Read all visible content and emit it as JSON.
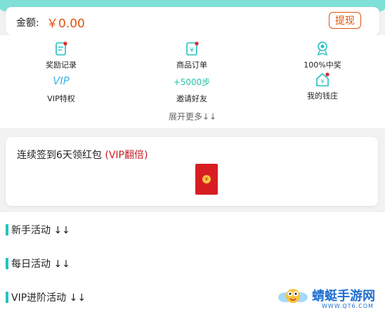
{
  "balance": {
    "label": "金额:",
    "value": "￥0.00",
    "withdraw_label": "提现"
  },
  "grid": [
    {
      "label": "奖励记录",
      "icon": "reward-record-icon"
    },
    {
      "label": "商品订单",
      "icon": "product-order-icon"
    },
    {
      "label": "100%中奖",
      "icon": "prize-medal-icon"
    },
    {
      "label": "VIP特权",
      "top_text": "VIP"
    },
    {
      "label": "邀请好友",
      "top_text": "+5000步"
    },
    {
      "label": "我的钱庄",
      "icon": "money-house-icon"
    }
  ],
  "expand_more": "展开更多↓↓",
  "checkin": {
    "title": "连续签到6天领红包 ",
    "vip_note": "(VIP翻倍)",
    "packet_icon": "red-packet-icon"
  },
  "activities": [
    {
      "label": "新手活动 ↓↓"
    },
    {
      "label": "每日活动 ↓↓"
    },
    {
      "label": "VIP进阶活动 ↓↓"
    }
  ],
  "watermark": {
    "brand": "蜻蜓手游网",
    "url": "WWW.QT6.COM"
  },
  "colors": {
    "accent_orange": "#e0530e",
    "teal": "#22c2c4",
    "vip_blue": "#3fb6ea",
    "steps_green": "#28c1a6",
    "packet_red": "#d81d22"
  }
}
